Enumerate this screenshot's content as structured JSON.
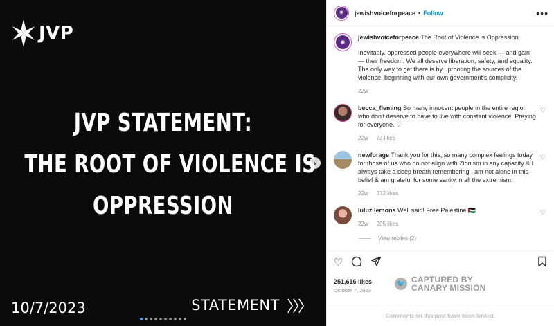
{
  "media": {
    "brand": "JVP",
    "headline": [
      "JVP STATEMENT:",
      "THE ROOT OF VIOLENCE IS",
      "OPPRESSION"
    ],
    "date": "10/7/2023",
    "statement_label": "STATEMENT",
    "statement_chevrons": "〉〉〉",
    "next_icon": "›",
    "carousel_dots": 10,
    "active_dot": 0
  },
  "header": {
    "username": "jewishvoiceforpeace",
    "separator": "•",
    "follow_label": "Follow",
    "more_icon": "•••"
  },
  "caption": {
    "username": "jewishvoiceforpeace",
    "title": "The Root of Violence is Oppression",
    "text": "Inevitably, oppressed people everywhere will seek — and gain — their freedom. We all deserve liberation, safety, and equality. The only way to get there is by uprooting the sources of the violence, beginning with our own government's complicity.",
    "age": "22w"
  },
  "comments": [
    {
      "username": "becca_fleming",
      "text": "So many innocent people in the entire region who don't deserve to have to live with constant violence. Praying for everyone. ♡",
      "age": "22w",
      "likes": "73 likes"
    },
    {
      "username": "newforage",
      "text": "Thank you for this, so many complex feelings today for those of us who do not align with Zionism in any capacity & I always take a deep breath remembering I am not alone in this belief & am grateful for some sanity in all the extremism.",
      "age": "22w",
      "likes": "372 likes"
    },
    {
      "username": "luluz.lemons",
      "text": "Well said! Free Palestine 🇵🇸",
      "age": "22w",
      "likes": "205 likes"
    }
  ],
  "view_replies": "View replies (2)",
  "likes": "251,616 likes",
  "post_date": "October 7, 2023",
  "watermark": {
    "line1": "CAPTURED BY",
    "line2": "CANARY MISSION"
  },
  "comments_limited": "Comments on this post have been limited."
}
